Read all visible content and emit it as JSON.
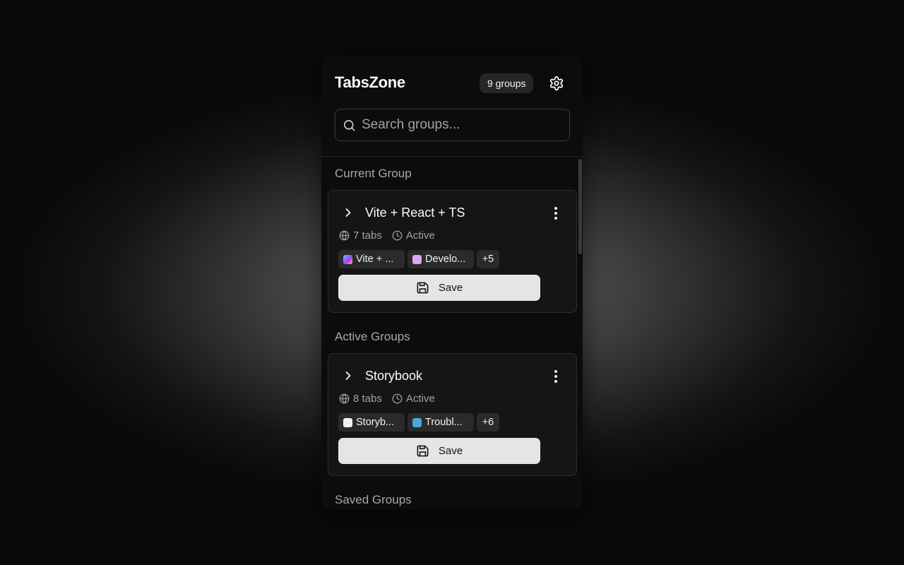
{
  "app": {
    "title": "TabsZone",
    "group_count": "9 groups"
  },
  "search": {
    "placeholder": "Search groups..."
  },
  "sections": {
    "current": "Current Group",
    "active": "Active Groups",
    "saved": "Saved Groups"
  },
  "groups": [
    {
      "title": "Vite + React + TS",
      "tabs": "7 tabs",
      "status": "Active",
      "chips": [
        "Vite + ...",
        "Develo..."
      ],
      "more": "+5",
      "save_label": "Save"
    },
    {
      "title": "Storybook",
      "tabs": "8 tabs",
      "status": "Active",
      "chips": [
        "Storyb...",
        "Troubl..."
      ],
      "more": "+6",
      "save_label": "Save"
    }
  ],
  "icons": {
    "settings": "gear-icon",
    "search": "search-icon",
    "expand": "chevron-right-icon",
    "menu": "more-vertical-icon",
    "tabs": "globe-icon",
    "status": "clock-icon",
    "save": "floppy-disk-icon"
  }
}
